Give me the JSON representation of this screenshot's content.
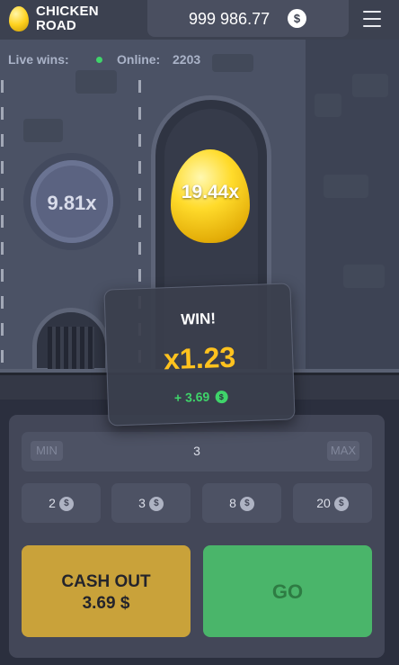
{
  "header": {
    "logo_line1": "CHICKEN",
    "logo_line2": "ROAD",
    "balance": "999 986.77",
    "currency_symbol": "$"
  },
  "stats": {
    "live_wins_label": "Live wins:",
    "online_label": "Online:",
    "online_count": "2203"
  },
  "lanes": {
    "passed_multiplier": "9.81x",
    "next_multiplier": "19.44x"
  },
  "win_popup": {
    "title": "WIN!",
    "multiplier": "x1.23",
    "amount": "+ 3.69",
    "currency_symbol": "$"
  },
  "bet": {
    "min_label": "MIN",
    "max_label": "MAX",
    "value": "3",
    "chips": [
      "2",
      "3",
      "8",
      "20"
    ],
    "currency_symbol": "$"
  },
  "actions": {
    "cashout_label": "CASH OUT",
    "cashout_amount": "3.69 $",
    "go_label": "GO"
  },
  "colors": {
    "accent_gold": "#ffc21e",
    "cashout_bg": "#c9a23a",
    "go_bg": "#4ab56a",
    "online_dot": "#3fd46a"
  }
}
